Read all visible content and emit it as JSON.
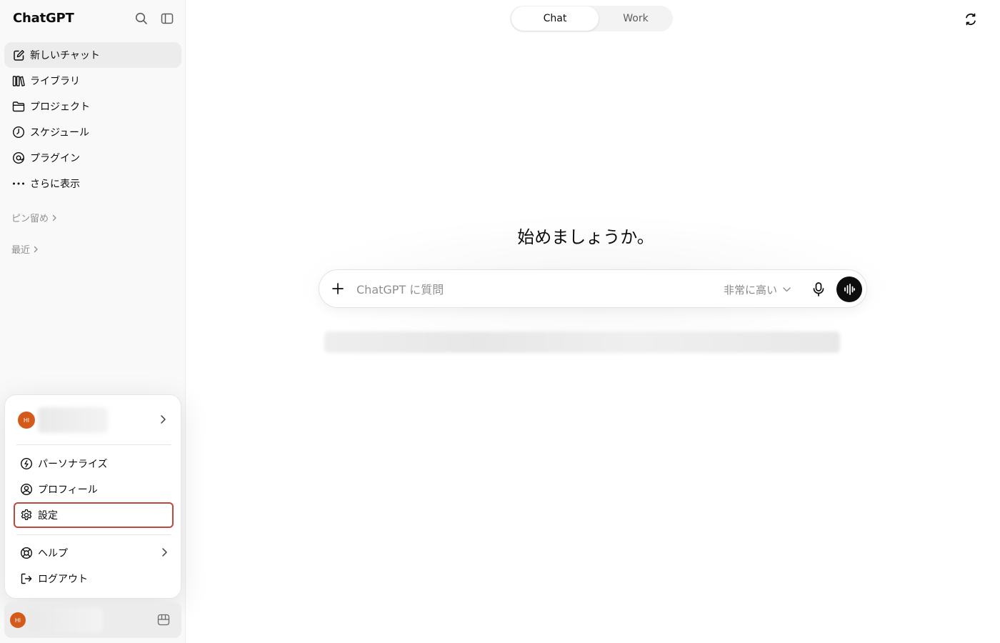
{
  "sidebar": {
    "brand": "ChatGPT",
    "nav": [
      {
        "label": "新しいチャット",
        "icon": "edit-icon",
        "active": true
      },
      {
        "label": "ライブラリ",
        "icon": "library-icon"
      },
      {
        "label": "プロジェクト",
        "icon": "folder-icon"
      },
      {
        "label": "スケジュール",
        "icon": "clock-icon"
      },
      {
        "label": "プラグイン",
        "icon": "plugin-icon"
      },
      {
        "label": "さらに表示",
        "icon": "more-icon"
      }
    ],
    "pinned_label": "ピン留め",
    "recent_label": "最近"
  },
  "account_menu": {
    "avatar_initials": "HI",
    "items": [
      {
        "label": "パーソナライズ",
        "icon": "personalize-icon"
      },
      {
        "label": "プロフィール",
        "icon": "profile-icon"
      },
      {
        "label": "設定",
        "icon": "gear-icon",
        "highlighted": true
      },
      {
        "label": "ヘルプ",
        "icon": "help-icon"
      },
      {
        "label": "ログアウト",
        "icon": "logout-icon"
      }
    ]
  },
  "bottom_account": {
    "avatar_initials": "HI"
  },
  "main": {
    "tabs": [
      {
        "label": "Chat",
        "selected": true
      },
      {
        "label": "Work",
        "selected": false
      }
    ],
    "heading": "始めましょうか。",
    "composer": {
      "placeholder": "ChatGPT に質問",
      "model_label": "非常に高い"
    }
  },
  "colors": {
    "avatar": "#d45a1a",
    "highlight_border": "#c0473a",
    "voice_button": "#0d0d0d"
  }
}
